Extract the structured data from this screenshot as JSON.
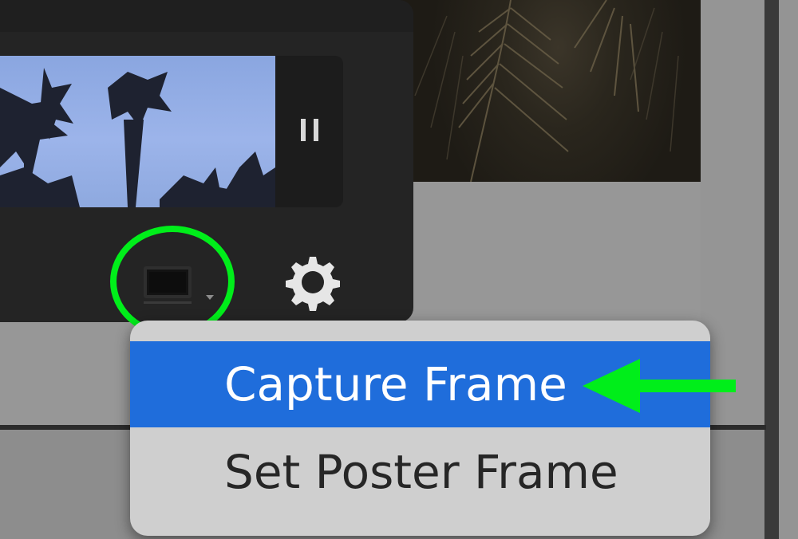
{
  "video_preview": {
    "pause_icon": "pause-icon"
  },
  "controls": {
    "frame_icon": "frame-capture-icon",
    "chevron_icon": "chevron-down-icon",
    "gear_icon": "gear-icon"
  },
  "menu": {
    "items": [
      {
        "label": "Capture Frame",
        "selected": true
      },
      {
        "label": "Set Poster Frame",
        "selected": false
      }
    ]
  },
  "annotations": {
    "highlight_color": "#00ee1a",
    "arrow_color": "#00ee1a"
  },
  "colors": {
    "menu_selected": "#1f6ddb",
    "panel_bg": "#242424"
  }
}
